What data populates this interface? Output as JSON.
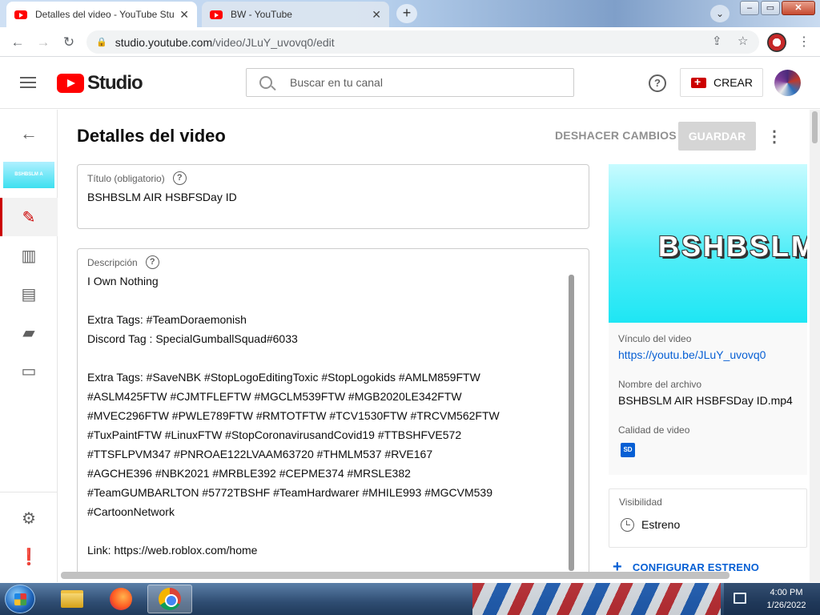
{
  "browser": {
    "tabs": [
      {
        "title": "Detalles del video - YouTube Studio",
        "active": true
      },
      {
        "title": "BW - YouTube",
        "active": false
      }
    ],
    "url_host": "studio.youtube.com",
    "url_path": "/video/JLuY_uvovq0/edit"
  },
  "header": {
    "logo_text": "Studio",
    "search_placeholder": "Buscar en tu canal",
    "create_label": "CREAR"
  },
  "page": {
    "title": "Detalles del video",
    "undo_label": "DESHACER CAMBIOS",
    "save_label": "GUARDAR"
  },
  "title_field": {
    "label": "Título (obligatorio)",
    "value": "BSHBSLM AIR HSBFSDay ID"
  },
  "description_field": {
    "label": "Descripción",
    "lines": [
      "I Own Nothing",
      "",
      "Extra Tags: #TeamDoraemonish",
      "Discord Tag : SpecialGumballSquad#6033",
      "",
      "Extra Tags: #SaveNBK #StopLogoEditingToxic #StopLogokids #AMLM859FTW",
      "#ASLM425FTW #CJMTFLEFTW #MGCLM539FTW #MGB2020LE342FTW",
      "#MVEC296FTW #PWLE789FTW #RMTOTFTW #TCV1530FTW #TRCVM562FTW",
      "#TuxPaintFTW #LinuxFTW #StopCoronavirusandCovid19 #TTBSHFVE572",
      "#TTSFLPVM347 #PNROAE122LVAAM63720 #THMLM537 #RVE167",
      "#AGCHE396 #NBK2021 #MRBLE392 #CEPME374 #MRSLE382",
      "#TeamGUMBARLTON #5772TBSHF #TeamHardwarer #MHILE993 #MGCVM539",
      "#CartoonNetwork",
      "",
      "Link: https://web.roblox.com/home"
    ]
  },
  "sidebar_panel": {
    "thumbnail_text": "BSHBSLM A",
    "video_link_label": "Vínculo del video",
    "video_link": "https://youtu.be/JLuY_uvovq0",
    "filename_label": "Nombre del archivo",
    "filename": "BSHBSLM AIR HSBFSDay ID.mp4",
    "quality_label": "Calidad de video",
    "quality_badge": "SD",
    "visibility_label": "Visibilidad",
    "visibility_value": "Estreno",
    "config_label": "CONFIGURAR ESTRENO"
  },
  "taskbar": {
    "time": "4:00 PM",
    "date": "1/26/2022"
  },
  "colors": {
    "youtube_red": "#ff0000",
    "link_blue": "#065fd4",
    "save_disabled": "#d5d5d5"
  }
}
